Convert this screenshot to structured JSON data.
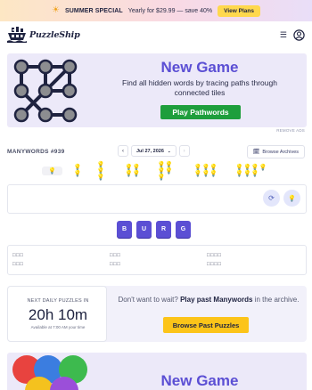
{
  "promo": {
    "title": "SUMMER SPECIAL",
    "offer": "Yearly for $29.99 — save 40%",
    "button": "View Plans",
    "sun_icon": "☀"
  },
  "header": {
    "brand": "PuzzleShip",
    "menu_icon": "☰"
  },
  "ad": {
    "headline": "New Game",
    "description_line1": "Find all hidden words by tracing paths through",
    "description_line2": "connected tiles",
    "cta": "Play Pathwords",
    "remove_ads": "REMOVE ADS"
  },
  "puzzle": {
    "title": "MANYWORDS #939",
    "prev": "‹",
    "date": "Jul 27, 2026",
    "date_chevron": "⌄",
    "next": "›",
    "archives_button": "Browse Archives",
    "archives_icon": "🗓",
    "hints": [
      "💡",
      "💡💡",
      "💡💡💡",
      "💡💡💡💡",
      "💡💡💡💡💡",
      "💡💡💡💡💡💡",
      "💡💡💡💡💡💡💡"
    ],
    "shuffle_icon": "⟳",
    "hint_icon": "💡",
    "tiles": [
      "B",
      "U",
      "R",
      "G"
    ],
    "found_slots": {
      "col1": [
        "□□□",
        "□□□"
      ],
      "col2": [
        "□□□",
        "□□□"
      ],
      "col3": [
        "□□□□",
        "□□□□"
      ]
    }
  },
  "countdown": {
    "label": "NEXT DAILY PUZZLES IN",
    "time": "20h 10m",
    "available": "Available at 7:00 AM your time",
    "message_prefix": "Don't want to wait? ",
    "message_bold": "Play past Manywords",
    "message_suffix": " in the archive.",
    "button": "Browse Past Puzzles"
  },
  "ad2": {
    "headline": "New Game"
  },
  "colors": {
    "accent": "#5b4fd4",
    "cta_green": "#1e9e3c",
    "cta_yellow": "#fcc419",
    "promo_button": "#ffd84d"
  }
}
